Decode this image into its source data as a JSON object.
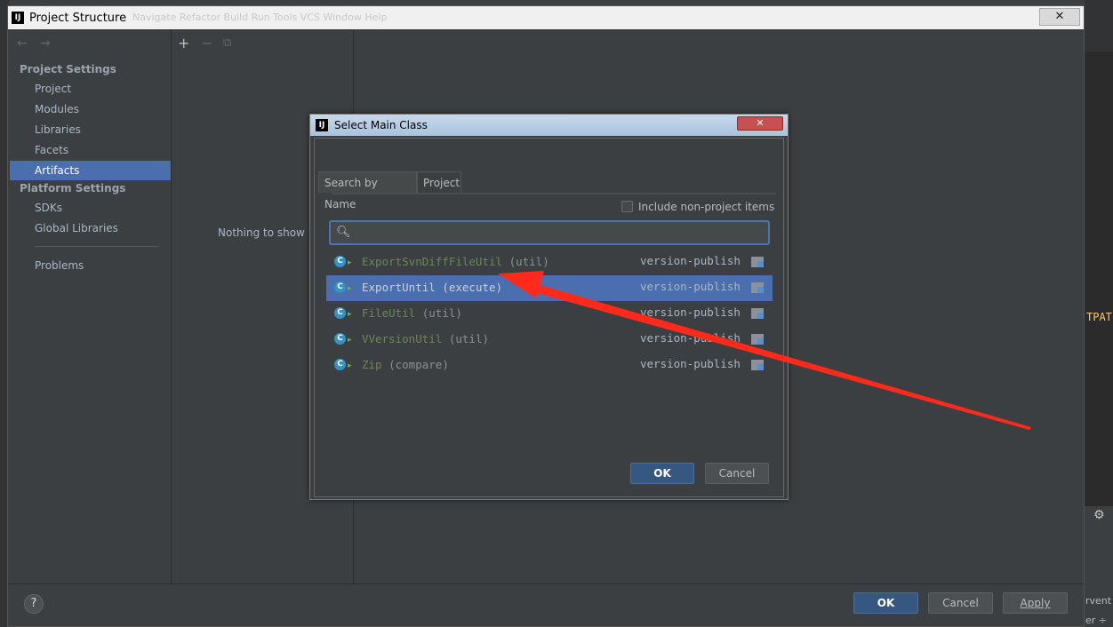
{
  "window": {
    "title": "Project Structure",
    "close_glyph": "✕",
    "menu_ghost": "Navigate  Refactor  Build  Run  Tools  VCS  Window  Help"
  },
  "nav": {
    "back": "←",
    "forward": "→"
  },
  "sidebar": {
    "project_settings": "Project Settings",
    "items_project": [
      "Project",
      "Modules",
      "Libraries",
      "Facets",
      "Artifacts"
    ],
    "platform_settings": "Platform Settings",
    "items_platform": [
      "SDKs",
      "Global Libraries"
    ],
    "problems": "Problems",
    "selected": "Artifacts"
  },
  "mid": {
    "add": "+",
    "remove": "−",
    "copy": "⧉",
    "empty_text": "Nothing to show"
  },
  "footer": {
    "help": "?",
    "ok": "OK",
    "cancel": "Cancel",
    "apply": "Apply"
  },
  "dialog": {
    "title": "Select Main Class",
    "close_glyph": "✕",
    "tabs": [
      "Search by Name",
      "Project"
    ],
    "active_tab": "Project",
    "include_label": "Include non-project items",
    "include_checked": false,
    "search_value": "",
    "rows": [
      {
        "name": "ExportSvnDiffFileUtil",
        "pkg": "(util)",
        "module": "version-publish",
        "selected": false
      },
      {
        "name": "ExportUntil",
        "pkg": "(execute)",
        "module": "version-publish",
        "selected": true
      },
      {
        "name": "FileUtil",
        "pkg": "(util)",
        "module": "version-publish",
        "selected": false
      },
      {
        "name": "VVersionUtil",
        "pkg": "(util)",
        "module": "version-publish",
        "selected": false
      },
      {
        "name": "Zip",
        "pkg": "(compare)",
        "module": "version-publish",
        "selected": false
      }
    ],
    "ok": "OK",
    "cancel": "Cancel"
  },
  "background_ide": {
    "code_fragment": "TPAT",
    "status_1": "rvent",
    "status_2": "er ÷"
  },
  "colors": {
    "background": "#3c3f41",
    "selection": "#4b6eaf",
    "class_name": "#6a8759",
    "annotation_arrow": "#ff2a1a"
  }
}
